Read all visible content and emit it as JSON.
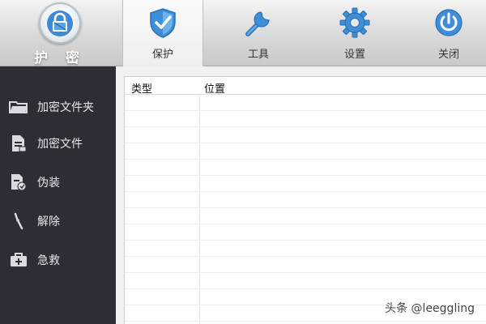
{
  "app": {
    "logo_text": "护 密"
  },
  "toolbar": {
    "tabs": [
      {
        "label": "保护",
        "icon": "shield-check-icon"
      },
      {
        "label": "工具",
        "icon": "wrench-icon"
      },
      {
        "label": "设置",
        "icon": "gear-icon"
      },
      {
        "label": "关闭",
        "icon": "power-icon"
      }
    ],
    "active_tab": "保护"
  },
  "sidebar": {
    "items": [
      {
        "label": "加密文件夹",
        "icon": "folder-icon"
      },
      {
        "label": "加密文件",
        "icon": "document-icon"
      },
      {
        "label": "伪装",
        "icon": "disguise-document-icon"
      },
      {
        "label": "解除",
        "icon": "unlink-icon"
      },
      {
        "label": "急救",
        "icon": "first-aid-kit-icon"
      }
    ]
  },
  "table": {
    "columns": [
      "类型",
      "位置"
    ],
    "rows": []
  },
  "watermark": "头条 @leeggling",
  "colors": {
    "sidebar_bg": "#2b2f35",
    "accent_blue": "#3f8fd8",
    "toolbar_bg": "#d9d9d9"
  }
}
